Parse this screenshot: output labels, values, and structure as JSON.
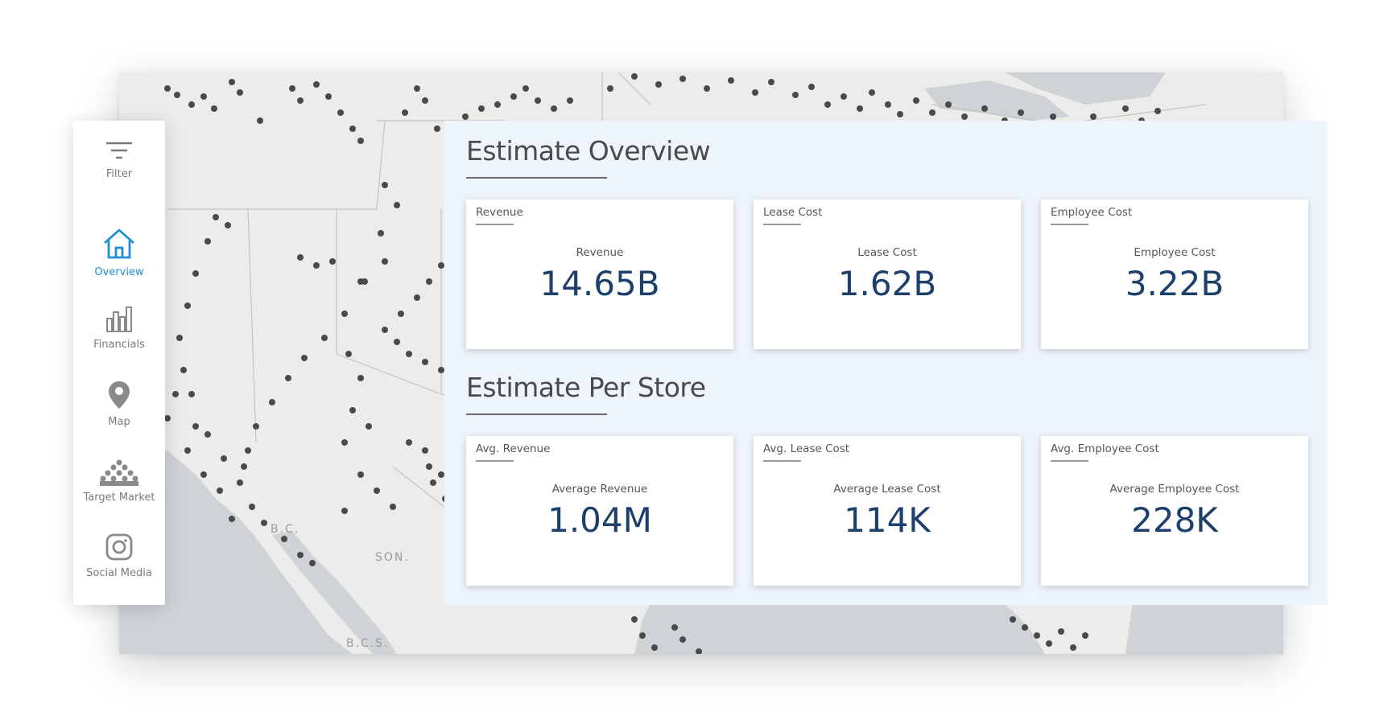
{
  "map": {
    "labels": {
      "bc": "B.C.",
      "son": "SON.",
      "bcs": "B.C.S."
    }
  },
  "sidebar": {
    "items": [
      {
        "label": "Filter",
        "icon": "filter-icon"
      },
      {
        "label": "Overview",
        "icon": "home-icon",
        "active": true
      },
      {
        "label": "Financials",
        "icon": "bar-chart-icon"
      },
      {
        "label": "Map",
        "icon": "map-pin-icon"
      },
      {
        "label": "Target Market",
        "icon": "people-group-icon"
      },
      {
        "label": "Social Media",
        "icon": "instagram-icon"
      }
    ]
  },
  "overview": {
    "title": "Estimate Overview",
    "cards": [
      {
        "title": "Revenue",
        "label": "Revenue",
        "value": "14.65B"
      },
      {
        "title": "Lease Cost",
        "label": "Lease Cost",
        "value": "1.62B"
      },
      {
        "title": "Employee Cost",
        "label": "Employee Cost",
        "value": "3.22B"
      }
    ]
  },
  "per_store": {
    "title": "Estimate Per Store",
    "cards": [
      {
        "title": "Avg. Revenue",
        "label": "Average Revenue",
        "value": "1.04M"
      },
      {
        "title": "Avg. Lease Cost",
        "label": "Average Lease Cost",
        "value": "114K"
      },
      {
        "title": "Avg. Employee Cost",
        "label": "Average Employee Cost",
        "value": "228K"
      }
    ]
  },
  "colors": {
    "accent": "#1e8fd1",
    "value_text": "#1c3f6b",
    "panel_bg": "#eef4fb",
    "map_land": "#ececea",
    "map_water": "#cfd3d6",
    "store_dot": "#4a4a4a"
  }
}
